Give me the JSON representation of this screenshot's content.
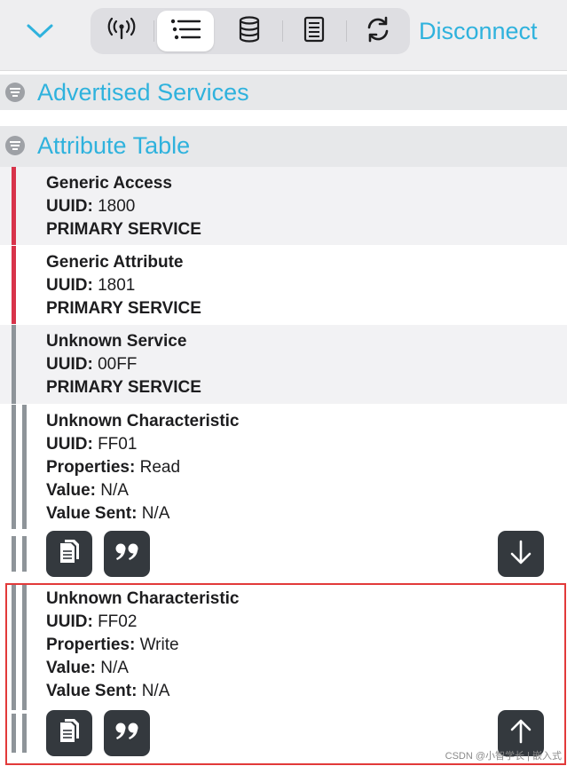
{
  "toolbar": {
    "collapse_icon": "chevron-down-icon",
    "segments": [
      {
        "icon": "antenna-icon",
        "active": false
      },
      {
        "icon": "list-icon",
        "active": true
      },
      {
        "icon": "database-icon",
        "active": false
      },
      {
        "icon": "log-icon",
        "active": false
      },
      {
        "icon": "refresh-icon",
        "active": false
      }
    ],
    "disconnect_label": "Disconnect",
    "accent": "#2fb2dd"
  },
  "sections": {
    "advertised": {
      "title": "Advertised Services"
    },
    "attributes": {
      "title": "Attribute Table"
    }
  },
  "services": [
    {
      "name": "Generic Access",
      "uuid_label": "UUID:",
      "uuid": "1800",
      "type": "PRIMARY SERVICE",
      "bar_color": "#d8334a"
    },
    {
      "name": "Generic Attribute",
      "uuid_label": "UUID:",
      "uuid": "1801",
      "type": "PRIMARY SERVICE",
      "bar_color": "#d8334a"
    },
    {
      "name": "Unknown Service",
      "uuid_label": "UUID:",
      "uuid": "00FF",
      "type": "PRIMARY SERVICE",
      "bar_color": "#8e9499"
    }
  ],
  "characteristics": [
    {
      "name": "Unknown Characteristic",
      "uuid_label": "UUID:",
      "uuid": "FF01",
      "properties_label": "Properties:",
      "properties": "Read",
      "value_label": "Value:",
      "value": "N/A",
      "value_sent_label": "Value Sent:",
      "value_sent": "N/A",
      "action_icon": "arrow-down-icon"
    },
    {
      "name": "Unknown Characteristic",
      "uuid_label": "UUID:",
      "uuid": "FF02",
      "properties_label": "Properties:",
      "properties": "Write",
      "value_label": "Value:",
      "value": "N/A",
      "value_sent_label": "Value Sent:",
      "value_sent": "N/A",
      "action_icon": "arrow-up-icon"
    }
  ],
  "watermark": "CSDN @小智学长 | 嵌入式"
}
